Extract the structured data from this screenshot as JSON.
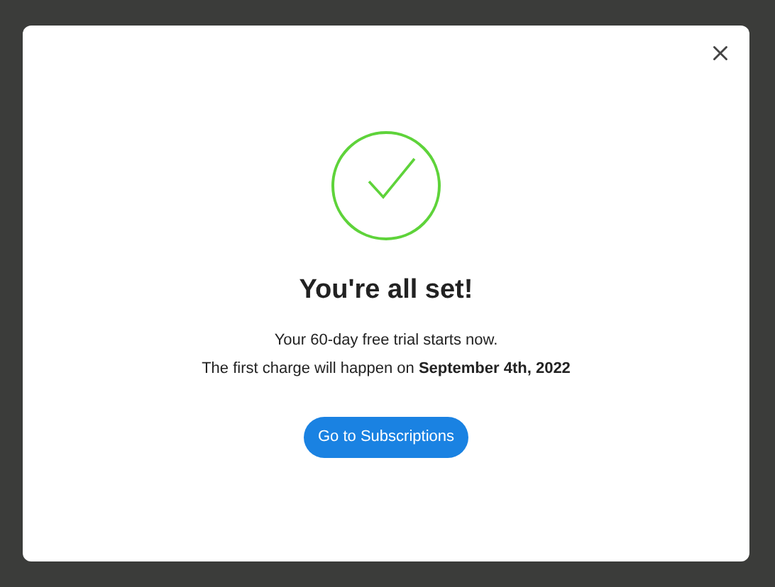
{
  "dialog": {
    "title": "You're all set!",
    "lines": [
      "Your 60-day free trial starts now.",
      "The first charge will happen on **September 4th, 2022**"
    ],
    "button": "Go to Subscriptions"
  }
}
